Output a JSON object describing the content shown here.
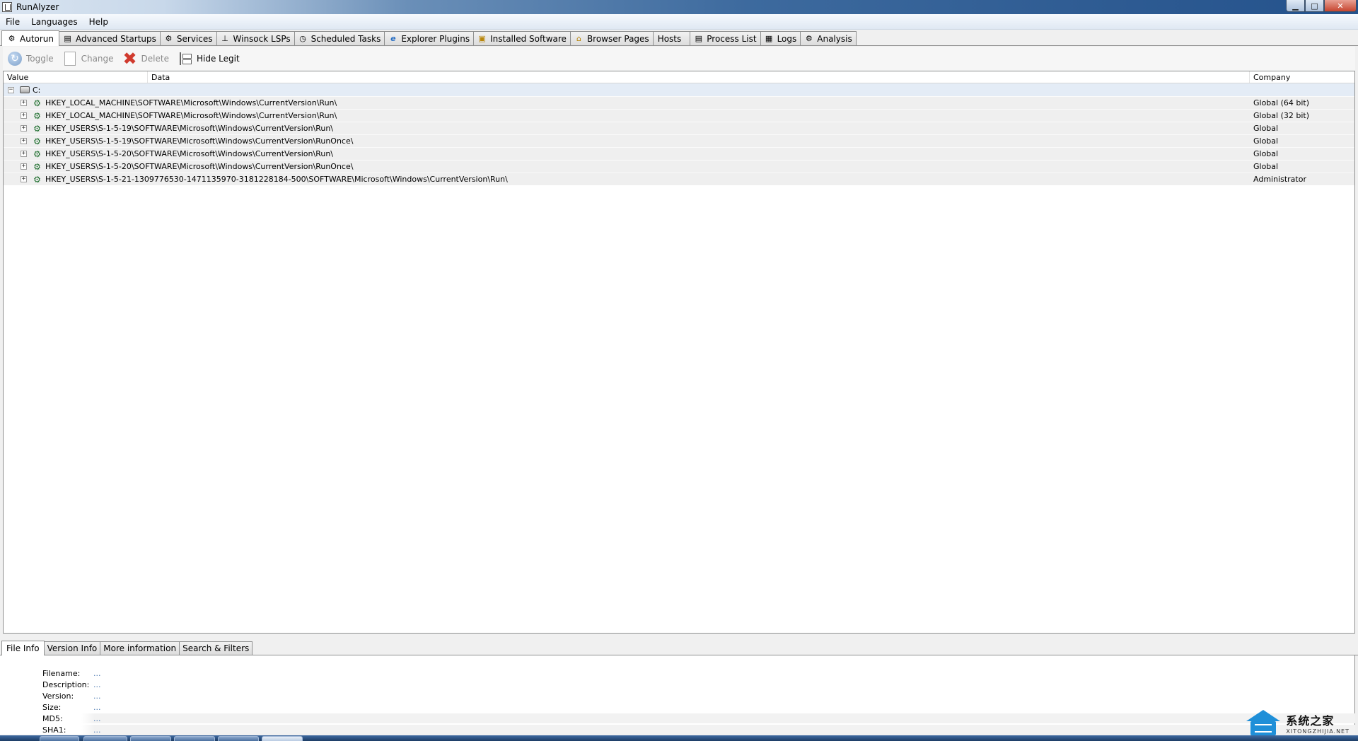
{
  "window": {
    "title": "RunAlyzer",
    "btn_min": "▁",
    "btn_max": "□",
    "btn_close": "✕"
  },
  "menu": [
    "File",
    "Languages",
    "Help"
  ],
  "tabs": [
    {
      "label": "Autorun",
      "icon": "gear-icon",
      "glyph": "⚙",
      "active": true
    },
    {
      "label": "Advanced Startups",
      "icon": "drive-icon",
      "glyph": "▤"
    },
    {
      "label": "Services",
      "icon": "gears-icon",
      "glyph": "⚙"
    },
    {
      "label": "Winsock LSPs",
      "icon": "network-icon",
      "glyph": "⊥"
    },
    {
      "label": "Scheduled Tasks",
      "icon": "clock-icon",
      "glyph": "◷"
    },
    {
      "label": "Explorer Plugins",
      "icon": "ie-icon",
      "glyph": "e"
    },
    {
      "label": "Installed Software",
      "icon": "package-icon",
      "glyph": "▣"
    },
    {
      "label": "Browser Pages",
      "icon": "home-icon",
      "glyph": "⌂"
    },
    {
      "label": "Hosts",
      "icon": "",
      "glyph": ""
    },
    {
      "label": "Process List",
      "icon": "process-icon",
      "glyph": "▤"
    },
    {
      "label": "Logs",
      "icon": "log-icon",
      "glyph": "▦"
    },
    {
      "label": "Analysis",
      "icon": "analysis-icon",
      "glyph": "⚙"
    }
  ],
  "toolbar": {
    "toggle": "Toggle",
    "toggle_glyph": "↻",
    "change": "Change",
    "delete": "Delete",
    "delete_glyph": "✖",
    "hide_legit": "Hide Legit"
  },
  "grid": {
    "columns": {
      "value": "Value",
      "data": "Data",
      "company": "Company"
    },
    "root": {
      "label": "C:",
      "expander": "−"
    },
    "rows": [
      {
        "path": "HKEY_LOCAL_MACHINE\\SOFTWARE\\Microsoft\\Windows\\CurrentVersion\\Run\\",
        "company": "Global (64 bit)"
      },
      {
        "path": "HKEY_LOCAL_MACHINE\\SOFTWARE\\Microsoft\\Windows\\CurrentVersion\\Run\\",
        "company": "Global (32 bit)"
      },
      {
        "path": "HKEY_USERS\\S-1-5-19\\SOFTWARE\\Microsoft\\Windows\\CurrentVersion\\Run\\",
        "company": "Global"
      },
      {
        "path": "HKEY_USERS\\S-1-5-19\\SOFTWARE\\Microsoft\\Windows\\CurrentVersion\\RunOnce\\",
        "company": "Global"
      },
      {
        "path": "HKEY_USERS\\S-1-5-20\\SOFTWARE\\Microsoft\\Windows\\CurrentVersion\\Run\\",
        "company": "Global"
      },
      {
        "path": "HKEY_USERS\\S-1-5-20\\SOFTWARE\\Microsoft\\Windows\\CurrentVersion\\RunOnce\\",
        "company": "Global"
      },
      {
        "path": "HKEY_USERS\\S-1-5-21-1309776530-1471135970-3181228184-500\\SOFTWARE\\Microsoft\\Windows\\CurrentVersion\\Run\\",
        "company": "Administrator"
      }
    ],
    "row_expander": "+",
    "row_glyph": "⚙"
  },
  "bottom_tabs": [
    {
      "label": "File Info",
      "active": true
    },
    {
      "label": "Version Info"
    },
    {
      "label": "More information"
    },
    {
      "label": "Search & Filters"
    }
  ],
  "file_info": [
    {
      "label": "Filename:",
      "value": "..."
    },
    {
      "label": "Description:",
      "value": "..."
    },
    {
      "label": "Version:",
      "value": "..."
    },
    {
      "label": "Size:",
      "value": "..."
    },
    {
      "label": "MD5:",
      "value": "..."
    },
    {
      "label": "SHA1:",
      "value": "..."
    }
  ],
  "watermark": {
    "cn": "系统之家",
    "en": "XITONGZHIJIA.NET"
  },
  "colors": {
    "accent": "#2f5c93",
    "selection": "#e4ecf6",
    "link_value": "#4a78b0",
    "watermark": "#1f8fd8"
  }
}
